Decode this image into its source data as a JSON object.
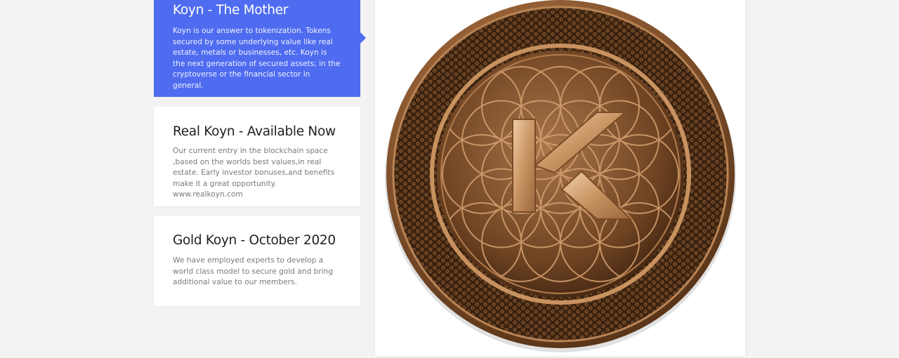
{
  "tabs": [
    {
      "title": "Koyn - The Mother",
      "text": "Koyn is our answer to tokenization. Tokens secured by some underlying value like real estate, metals or businesses, etc. Koyn is the next generation of secured assets; in the cryptoverse or the financial sector in general.",
      "active": true
    },
    {
      "title": "Real Koyn - Available Now",
      "text": "Our current entry in the blockchain space ,based on the worlds best values,in real estate. Early investor bonuses,and benefits make it a great opportunity. www.realkoyn.com",
      "active": false
    },
    {
      "title": "Gold Koyn - October 2020",
      "text": "We have employed experts to develop a world class model to secure gold and bring additional value to our members.",
      "active": false
    }
  ],
  "colors": {
    "active_tab": "#4f6cf0",
    "coin_bronze": "#8a5a32"
  },
  "image": {
    "icon": "koyn-coin-logo"
  }
}
